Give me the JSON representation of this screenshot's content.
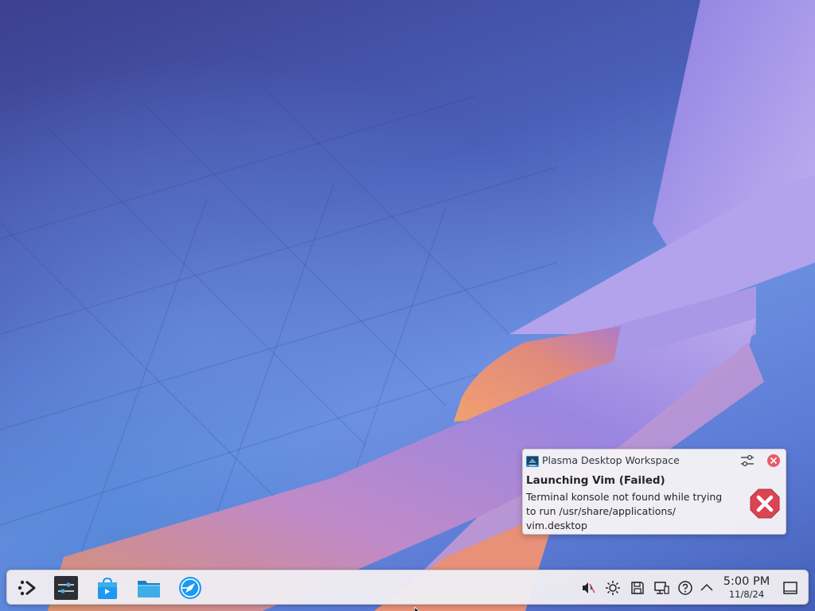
{
  "notification": {
    "app_name": "Plasma Desktop Workspace",
    "title": "Launching Vim (Failed)",
    "body": "Terminal konsole not found while trying to run /usr/share/applications/vim.desktop",
    "body_lines": [
      "Terminal konsole not found while trying",
      "to run /usr/share/applications/",
      "vim.desktop"
    ],
    "app_icon": "plasma-workspace-icon",
    "config_icon": "settings-sliders-icon",
    "close_icon": "close-circle-icon",
    "status_icon": "error-x-icon",
    "error_color": "#da4453"
  },
  "panel": {
    "launchers": [
      {
        "name": "application-launcher",
        "icon": "kde-launcher-icon"
      },
      {
        "name": "system-settings",
        "icon": "sliders-icon"
      },
      {
        "name": "discover",
        "icon": "shopping-bag-icon"
      },
      {
        "name": "dolphin",
        "icon": "folder-icon"
      },
      {
        "name": "plasma-browser",
        "icon": "kde-compass-icon"
      }
    ],
    "tray": [
      {
        "name": "volume",
        "icon": "speaker-muted-icon"
      },
      {
        "name": "brightness",
        "icon": "sun-icon"
      },
      {
        "name": "disks",
        "icon": "floppy-disk-icon"
      },
      {
        "name": "network",
        "icon": "network-monitor-icon"
      },
      {
        "name": "help",
        "icon": "question-circle-icon"
      },
      {
        "name": "expand",
        "icon": "chevron-up-icon"
      }
    ],
    "clock": {
      "time": "5:00 PM",
      "date": "11/8/24"
    },
    "show_desktop_icon": "show-desktop-icon"
  },
  "colors": {
    "panel_bg": "#eeecf2",
    "accent_blue": "#3daee9",
    "error_red": "#da4453"
  }
}
